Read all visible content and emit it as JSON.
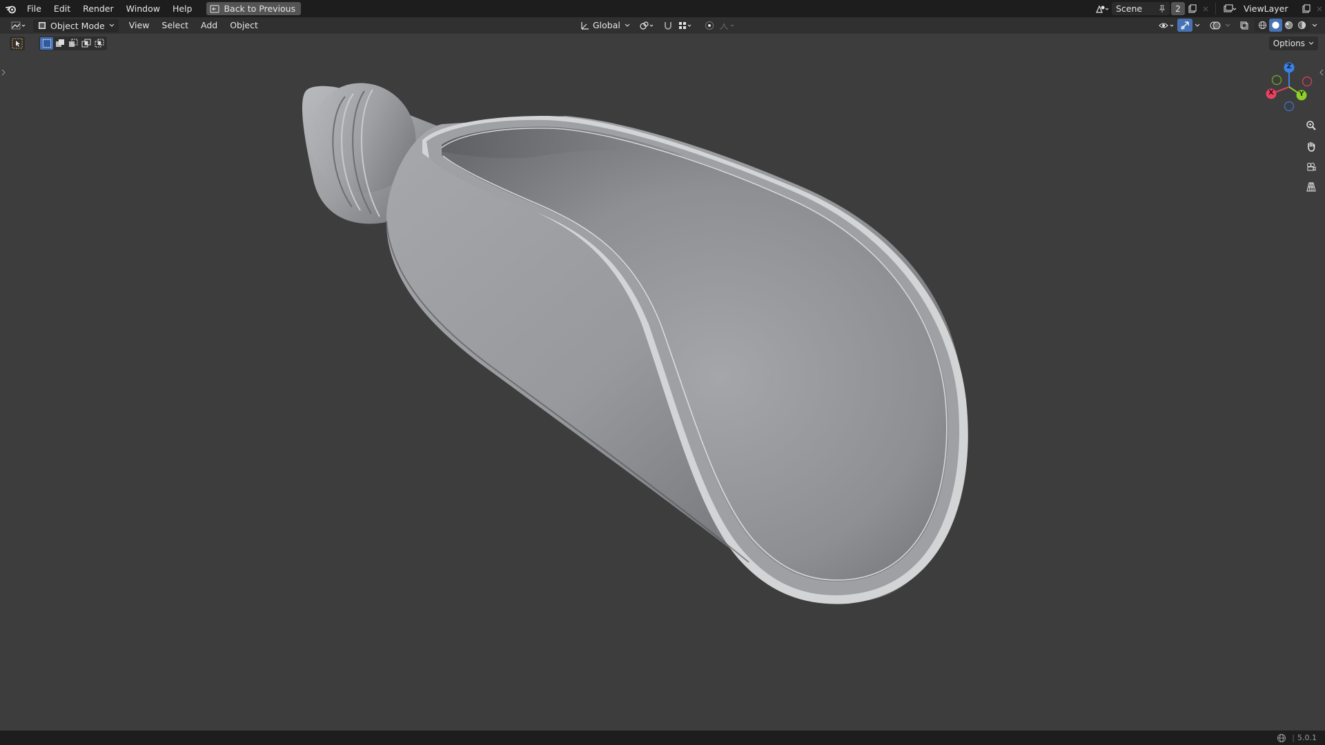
{
  "menubar": {
    "items": [
      "File",
      "Edit",
      "Render",
      "Window",
      "Help"
    ],
    "back_button": "Back to Previous"
  },
  "topright": {
    "scene_name": "Scene",
    "scene_users": "2",
    "view_layer": "ViewLayer"
  },
  "header": {
    "mode": "Object Mode",
    "menus": [
      "View",
      "Select",
      "Add",
      "Object"
    ],
    "transform_orientation": "Global"
  },
  "viewport": {
    "options_label": "Options",
    "gizmo": {
      "x_label": "X",
      "y_label": "Y",
      "z_label": "Z"
    },
    "colors": {
      "x_axis": "#e8425e",
      "y_axis": "#8fcf2a",
      "z_axis": "#3b82e8",
      "background": "#3d3d3d"
    }
  },
  "statusbar": {
    "version": "5.0.1"
  }
}
